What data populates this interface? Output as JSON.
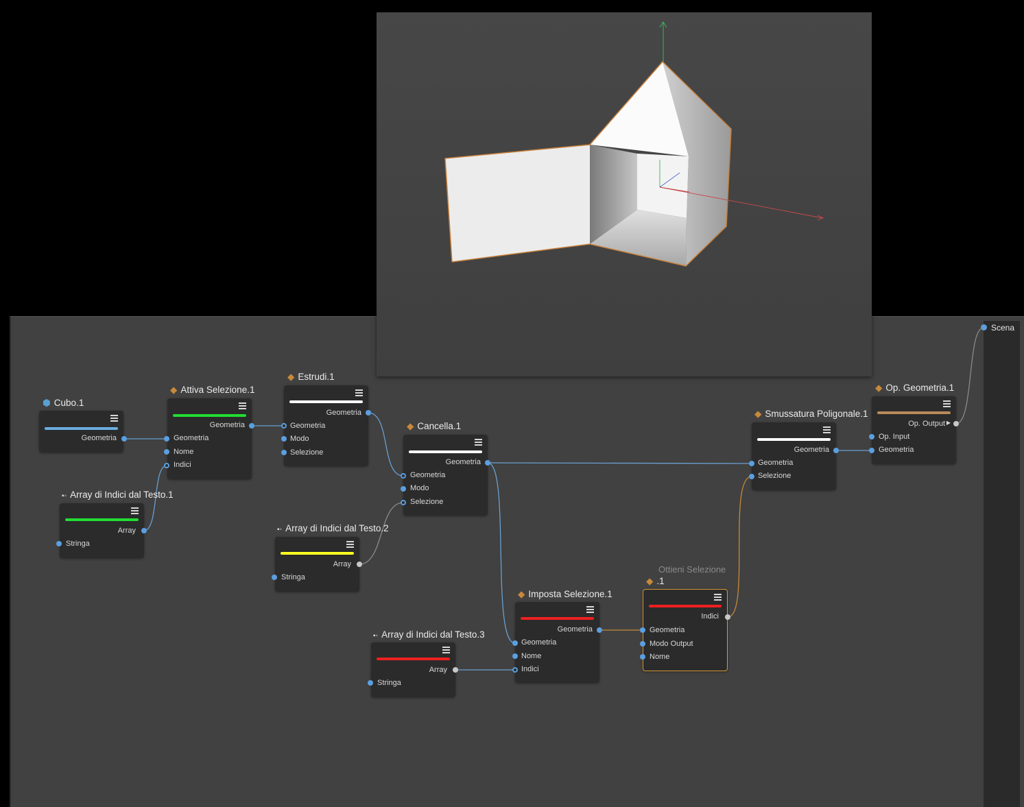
{
  "scene": {
    "label": "Scena"
  },
  "nodes": {
    "cubo": {
      "title": "Cubo.1",
      "ports": [
        "Geometria"
      ],
      "bar_color": "#6aaee0"
    },
    "attiva": {
      "title": "Attiva Selezione.1",
      "ports": [
        "Geometria",
        "Geometria",
        "Nome",
        "Indici"
      ],
      "bar_color": "#22dd33"
    },
    "estrudi": {
      "title": "Estrudi.1",
      "ports": [
        "Geometria",
        "Geometria",
        "Modo",
        "Selezione"
      ],
      "bar_color": "#ffffff"
    },
    "cancella": {
      "title": "Cancella.1",
      "ports": [
        "Geometria",
        "Geometria",
        "Modo",
        "Selezione"
      ],
      "bar_color": "#ffffff"
    },
    "smussatura": {
      "title": "Smussatura Poligonale.1",
      "ports": [
        "Geometria",
        "Geometria",
        "Selezione"
      ],
      "bar_color": "#ffffff"
    },
    "opgeom": {
      "title": "Op. Geometria.1",
      "ports": [
        "Op. Output",
        "Op. Input",
        "Geometria"
      ],
      "bar_color": "#b98a5a"
    },
    "array1": {
      "title": "Array di Indici dal Testo.1",
      "ports": [
        "Array",
        "Stringa"
      ],
      "bar_color": "#22dd33"
    },
    "array2": {
      "title": "Array di Indici dal Testo.2",
      "ports": [
        "Array",
        "Stringa"
      ],
      "bar_color": "#ffff22"
    },
    "array3": {
      "title": "Array di Indici dal Testo.3",
      "ports": [
        "Array",
        "Stringa"
      ],
      "bar_color": "#ee2020"
    },
    "imposta": {
      "title": "Imposta Selezione.1",
      "ports": [
        "Geometria",
        "Geometria",
        "Nome",
        "Indici"
      ],
      "bar_color": "#ee2020"
    },
    "ottieni": {
      "title_top": "Ottieni Selezione",
      "title": ".1",
      "ports": [
        "Indici",
        "Geometria",
        "Modo Output",
        "Nome"
      ],
      "bar_color": "#ee2020"
    }
  },
  "colors": {
    "wire_blue": "#6a9fd0",
    "wire_orange": "#c8893a",
    "wire_grey": "#8a8a8a",
    "selected_border": "#d99a3a"
  }
}
